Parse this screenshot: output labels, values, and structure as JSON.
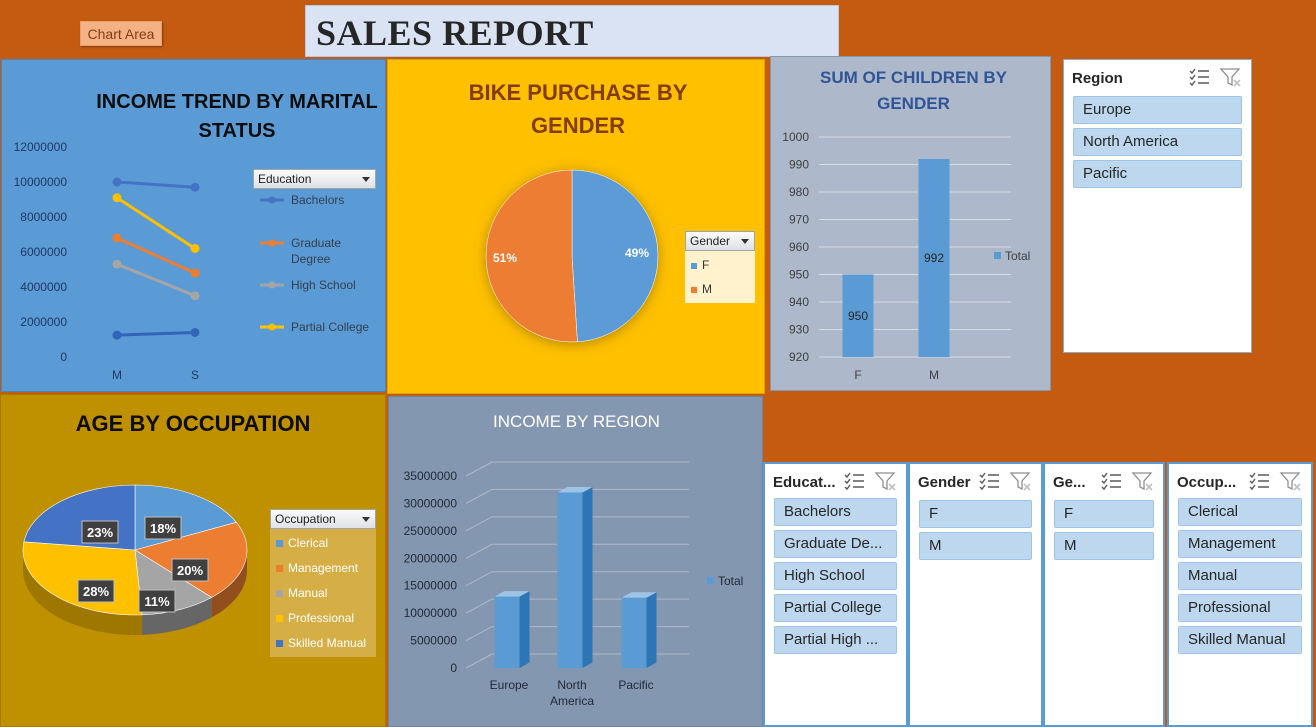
{
  "chart_area_label": "Chart Area",
  "report_title": "SALES REPORT",
  "income_trend": {
    "title_line1": "INCOME TREND BY MARITAL",
    "title_line2": "STATUS",
    "legend_title": "Education",
    "y_ticks": [
      "12000000",
      "10000000",
      "8000000",
      "6000000",
      "4000000",
      "2000000",
      "0"
    ],
    "colors": {
      "bachelors": "#4472C4",
      "graduate": "#ED7D31",
      "high_school": "#A5A5A5",
      "partial_college": "#FFC000"
    },
    "legend": [
      {
        "line1": "Bachelors",
        "line2": ""
      },
      {
        "line1": "Graduate",
        "line2": "Degree"
      },
      {
        "line1": "High School",
        "line2": ""
      },
      {
        "line1": "Partial College",
        "line2": ""
      }
    ]
  },
  "bike_purchase": {
    "title_line1": "BIKE PURCHASE BY",
    "title_line2": "GENDER",
    "legend_title": "Gender",
    "legend": [
      "F",
      "M"
    ],
    "colors": {
      "F": "#5B9BD5",
      "M": "#ED7D31"
    },
    "labels": {
      "F": "49%",
      "M": "51%"
    }
  },
  "children": {
    "title_line1": "SUM OF CHILDREN BY",
    "title_line2": "GENDER",
    "legend_label": "Total"
  },
  "age_occupation": {
    "title": "AGE BY OCCUPATION",
    "legend_title": "Occupation",
    "legend": [
      "Clerical",
      "Management",
      "Manual",
      "Professional",
      "Skilled Manual"
    ],
    "colors": [
      "#5B9BD5",
      "#ED7D31",
      "#A5A5A5",
      "#FFC000",
      "#4472C4"
    ]
  },
  "income_region": {
    "title": "INCOME BY REGION",
    "legend_label": "Total"
  },
  "slicers": {
    "region": {
      "title": "Region",
      "items": [
        "Europe",
        "North America",
        "Pacific"
      ]
    },
    "education": {
      "title": "Educat...",
      "items": [
        "Bachelors",
        "Graduate De...",
        "High School",
        "Partial College",
        "Partial High ..."
      ]
    },
    "gender": {
      "title": "Gender",
      "items": [
        "F",
        "M"
      ]
    },
    "gender2": {
      "title": "Ge...",
      "items": [
        "F",
        "M"
      ]
    },
    "occupation": {
      "title": "Occup...",
      "items": [
        "Clerical",
        "Management",
        "Manual",
        "Professional",
        "Skilled Manual"
      ]
    }
  },
  "chart_data": [
    {
      "type": "line",
      "title": "INCOME TREND BY MARITAL STATUS",
      "x": [
        "M",
        "S"
      ],
      "ylim": [
        0,
        12000000
      ],
      "legend": "right",
      "series": [
        {
          "name": "Bachelors",
          "values": [
            10000000,
            9700000
          ]
        },
        {
          "name": "Graduate Degree",
          "values": [
            6800000,
            4800000
          ]
        },
        {
          "name": "High School",
          "values": [
            5300000,
            3500000
          ]
        },
        {
          "name": "Partial College",
          "values": [
            9100000,
            6200000
          ]
        },
        {
          "values": [
            1250000,
            1400000
          ]
        }
      ]
    },
    {
      "type": "pie",
      "title": "BIKE PURCHASE BY GENDER",
      "categories": [
        "F",
        "M"
      ],
      "values": [
        49,
        51
      ],
      "legend": "right"
    },
    {
      "type": "bar",
      "title": "SUM OF CHILDREN BY GENDER",
      "categories": [
        "F",
        "M"
      ],
      "series": [
        {
          "name": "Total",
          "values": [
            950,
            992
          ]
        }
      ],
      "ylim": [
        920,
        1000
      ],
      "y_ticks": [
        1000,
        990,
        980,
        970,
        960,
        950,
        940,
        930,
        920
      ],
      "legend": "right"
    },
    {
      "type": "pie",
      "title": "AGE BY OCCUPATION",
      "categories": [
        "Clerical",
        "Management",
        "Manual",
        "Professional",
        "Skilled Manual"
      ],
      "values": [
        18,
        20,
        11,
        28,
        23
      ],
      "labels": [
        "18%",
        "20%",
        "11%",
        "28%",
        "23%"
      ],
      "legend": "right"
    },
    {
      "type": "bar",
      "title": "INCOME BY REGION",
      "categories": [
        "Europe",
        "North America",
        "Pacific"
      ],
      "series": [
        {
          "name": "Total",
          "values": [
            13000000,
            32000000,
            12800000
          ]
        }
      ],
      "ylim": [
        0,
        35000000
      ],
      "y_ticks": [
        "35000000",
        "30000000",
        "25000000",
        "20000000",
        "15000000",
        "10000000",
        "5000000",
        "0"
      ],
      "legend": "right"
    }
  ]
}
